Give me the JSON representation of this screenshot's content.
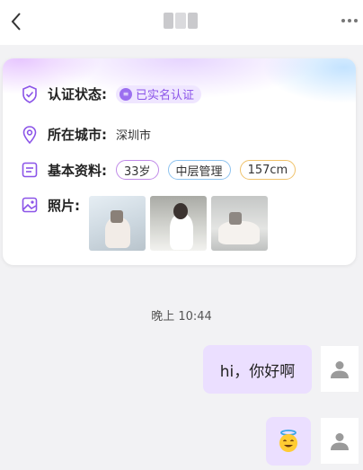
{
  "header": {
    "back_icon": "chevron-left-icon",
    "more_icon": "more-dots-icon"
  },
  "profile": {
    "verification": {
      "label": "认证状态:",
      "badge": "已实名认证"
    },
    "city": {
      "label": "所在城市:",
      "value": "深圳市"
    },
    "basic_info": {
      "label": "基本资料:",
      "tags": [
        "33岁",
        "中层管理",
        "157cm"
      ]
    },
    "photos": {
      "label": "照片:",
      "count": 3
    }
  },
  "chat": {
    "timestamp": "晚上 10:44",
    "messages": [
      {
        "sender": "me",
        "text": "hi，你好啊"
      },
      {
        "sender": "me",
        "text": "😇"
      }
    ]
  },
  "colors": {
    "accent": "#8b54e8",
    "bubble": "#ebdfff",
    "tag_purple": "#c08ae8",
    "tag_blue": "#8ec3ef",
    "tag_orange": "#f0c26a"
  }
}
